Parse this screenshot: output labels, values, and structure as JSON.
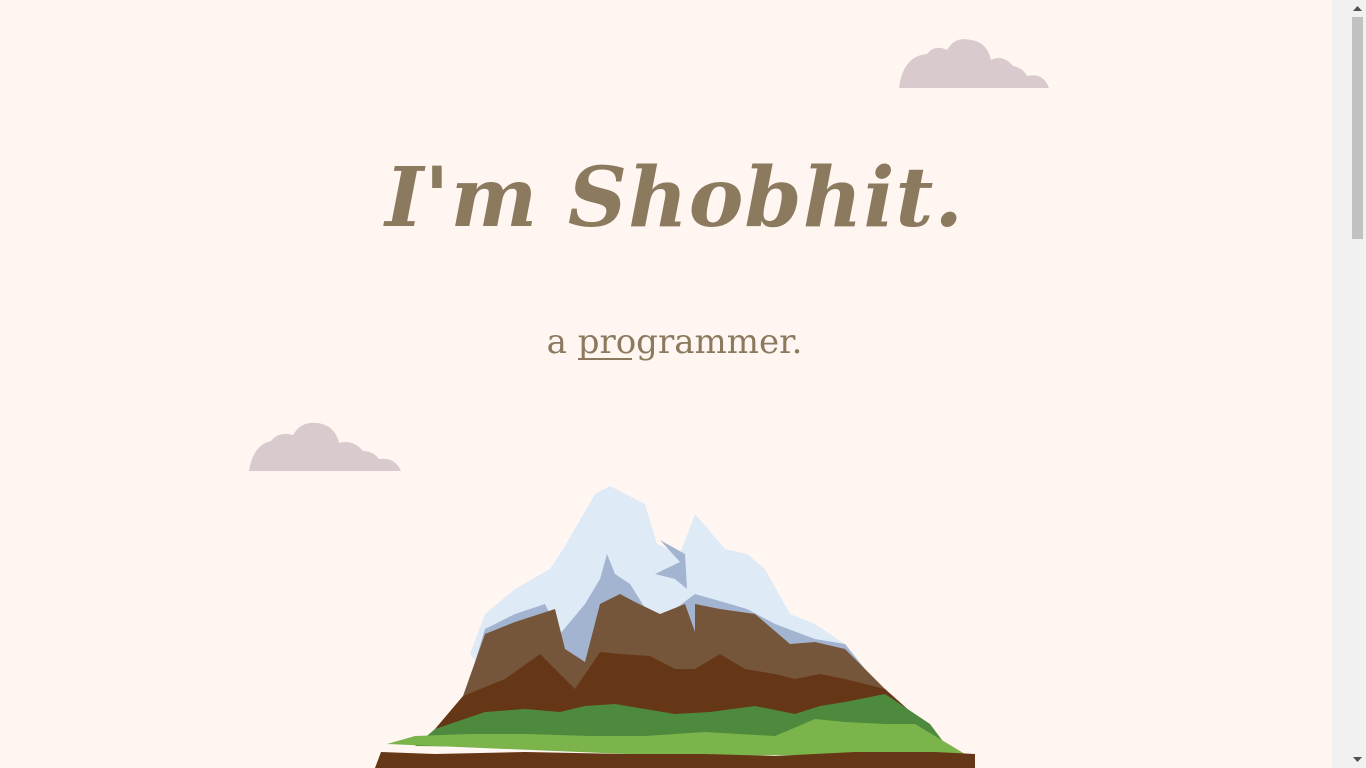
{
  "hero": {
    "title": "I'm Shobhit.",
    "tagline_prefix": "a ",
    "tagline_role": "programmer."
  },
  "colors": {
    "background": "#fff6f2",
    "text": "#8b7a5e",
    "cloud": "#d9cbcd",
    "snow_light": "#dfeaf7",
    "snow_shadow": "#a2b4cf",
    "rock_light": "#76563a",
    "rock_dark": "#663717",
    "grass_dark": "#4e8a3e",
    "grass_light": "#7ab44a"
  },
  "icons": {
    "cloud": "cloud-icon",
    "mountain": "mountain-illustration",
    "scroll_up": "triangle-up-icon",
    "scroll_down": "triangle-down-icon"
  }
}
